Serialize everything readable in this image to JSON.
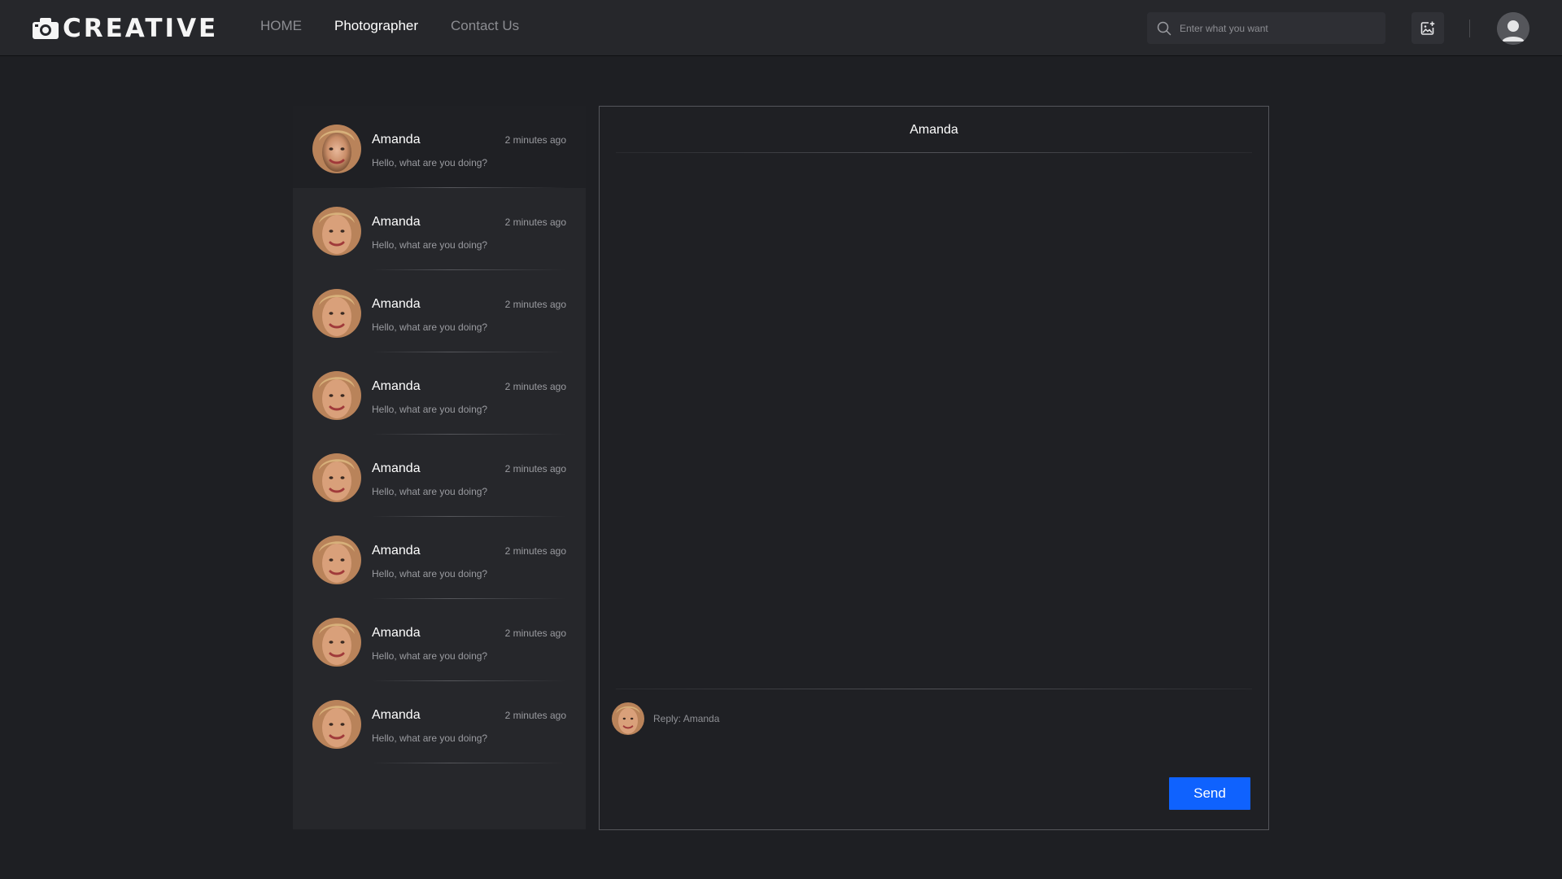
{
  "header": {
    "logo_text": "CREATIVE",
    "nav": [
      {
        "label": "HOME",
        "active": false
      },
      {
        "label": "Photographer",
        "active": true
      },
      {
        "label": "Contact Us",
        "active": false
      }
    ],
    "search_placeholder": "Enter what you want",
    "upload_icon": "image-upload-icon",
    "profile_icon": "user-avatar-icon"
  },
  "conversations": [
    {
      "name": "Amanda",
      "time": "2 minutes ago",
      "preview": "Hello, what are you doing?",
      "selected": true
    },
    {
      "name": "Amanda",
      "time": "2 minutes ago",
      "preview": "Hello, what are you doing?",
      "selected": false
    },
    {
      "name": "Amanda",
      "time": "2 minutes ago",
      "preview": "Hello, what are you doing?",
      "selected": false
    },
    {
      "name": "Amanda",
      "time": "2 minutes ago",
      "preview": "Hello, what are you doing?",
      "selected": false
    },
    {
      "name": "Amanda",
      "time": "2 minutes ago",
      "preview": "Hello, what are you doing?",
      "selected": false
    },
    {
      "name": "Amanda",
      "time": "2 minutes ago",
      "preview": "Hello, what are you doing?",
      "selected": false
    },
    {
      "name": "Amanda",
      "time": "2 minutes ago",
      "preview": "Hello, what are you doing?",
      "selected": false
    },
    {
      "name": "Amanda",
      "time": "2 minutes ago",
      "preview": "Hello, what are you doing?",
      "selected": false
    }
  ],
  "chat": {
    "title": "Amanda",
    "reply_prefix": "Reply:",
    "reply_to": "Amanda",
    "send_label": "Send"
  },
  "colors": {
    "background": "#1e1f23",
    "topbar": "#26272b",
    "accent": "#0f62fe"
  }
}
